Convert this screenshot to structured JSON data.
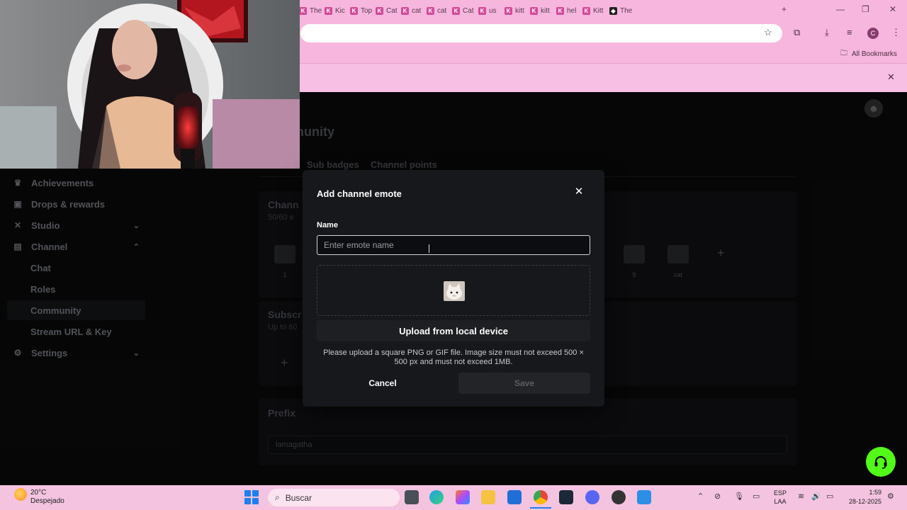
{
  "browser": {
    "tabs": [
      {
        "label": "The",
        "icon": "kick-k-icon"
      },
      {
        "label": "Kic",
        "icon": "kick-k-icon"
      },
      {
        "label": "Top",
        "icon": "kick-k-icon"
      },
      {
        "label": "Cat",
        "icon": "kick-k-icon"
      },
      {
        "label": "cat",
        "icon": "kick-k-icon"
      },
      {
        "label": "cat",
        "icon": "kick-k-icon"
      },
      {
        "label": "Cat",
        "icon": "kick-k-icon"
      },
      {
        "label": "us",
        "icon": "kick-k-icon"
      },
      {
        "label": "kitt",
        "icon": "kick-k-icon"
      },
      {
        "label": "kitt",
        "icon": "kick-k-icon"
      },
      {
        "label": "hel",
        "icon": "kick-k-icon"
      },
      {
        "label": "Kitt",
        "icon": "kick-k-icon"
      },
      {
        "label": "The",
        "icon": "diamond-icon"
      }
    ],
    "all_bookmarks": "All Bookmarks",
    "profile_initial": "C"
  },
  "sidebar": {
    "items": [
      {
        "label": "Achievements",
        "icon": "trophy-icon"
      },
      {
        "label": "Drops & rewards",
        "icon": "gift-icon"
      },
      {
        "label": "Studio",
        "icon": "studio-icon"
      },
      {
        "label": "Channel",
        "icon": "channel-icon"
      },
      {
        "label": "Chat"
      },
      {
        "label": "Roles"
      },
      {
        "label": "Community"
      },
      {
        "label": "Stream URL & Key"
      },
      {
        "label": "Settings",
        "icon": "gear-icon"
      }
    ]
  },
  "page": {
    "title": "nunity",
    "tabs": [
      "Sub badges",
      "Channel points"
    ],
    "channel_emotes_title": "Chann",
    "channel_emotes_count": "50/60 e",
    "emote_labels": [
      "1",
      "9",
      "cat"
    ],
    "subs_title": "Subscr",
    "subs_sub": "Up to 60",
    "prefix_title": "Prefix",
    "prefix_value": "lamagatha"
  },
  "modal": {
    "title": "Add channel emote",
    "name_label": "Name",
    "name_placeholder": "Enter emote name",
    "upload_label": "Upload from local device",
    "hint": "Please upload a square PNG or GIF file. Image size must not exceed 500 × 500 px and must not exceed 1MB.",
    "cancel_label": "Cancel",
    "save_label": "Save"
  },
  "taskbar": {
    "temperature": "20°C",
    "weather": "Despejado",
    "search_label": "Buscar",
    "lang_line1": "ESP",
    "lang_line2": "LAA",
    "time": "1:59",
    "date": "28-12-2025"
  },
  "colors": {
    "browser_frame": "#f6b6de",
    "modal_bg": "#17181c",
    "kick_green": "#53fc18"
  }
}
